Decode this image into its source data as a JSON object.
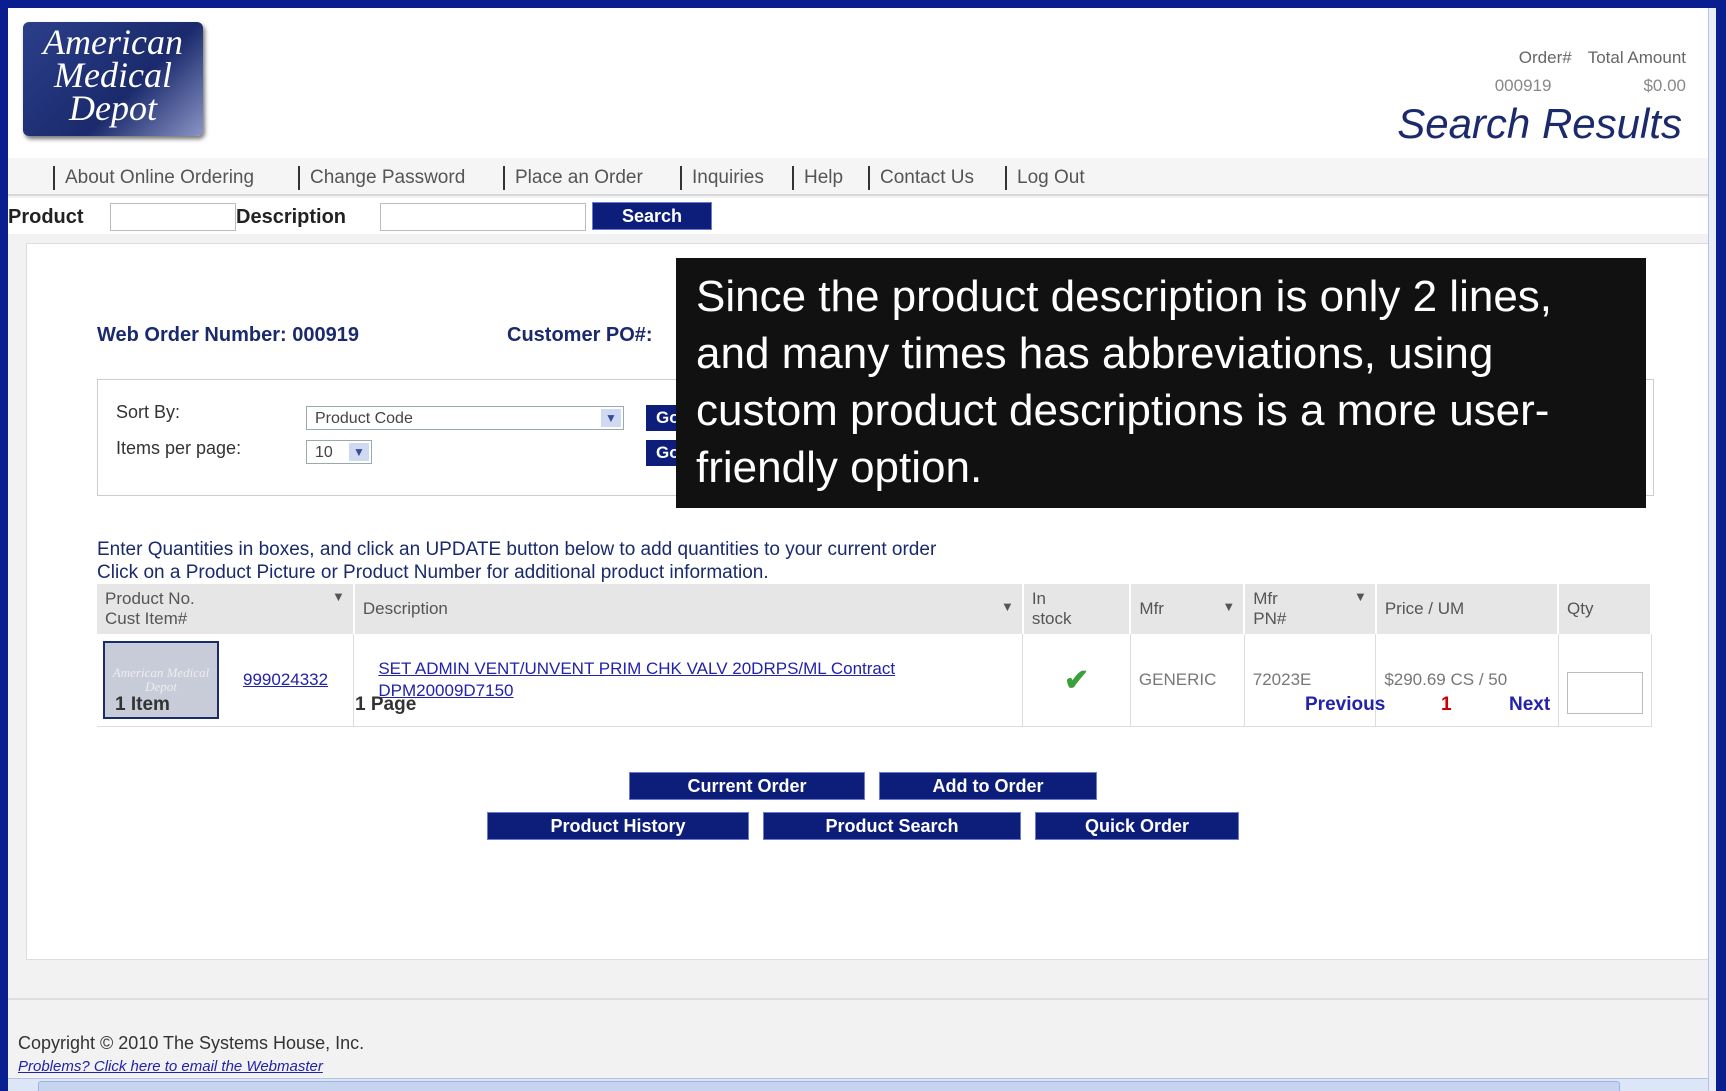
{
  "logo": {
    "lines": [
      "American",
      "Medical",
      "Depot"
    ]
  },
  "order_info": {
    "order_label": "Order#",
    "total_label": "Total Amount",
    "order_number": "000919",
    "total_amount": "$0.00"
  },
  "page_title": "Search Results",
  "nav": [
    "About Online Ordering",
    "Change Password",
    "Place an Order",
    "Inquiries",
    "Help",
    "Contact Us",
    "Log Out"
  ],
  "search": {
    "product_label": "Product",
    "description_label": "Description",
    "search_button": "Search"
  },
  "order": {
    "web_order_label": "Web Order Number: 000919",
    "customer_po_label": "Customer PO#:"
  },
  "sort": {
    "sort_by_label": "Sort By:",
    "sort_by_value": "Product Code",
    "items_per_page_label": "Items per page:",
    "items_per_page_value": "10",
    "go_label": "Go"
  },
  "instructions": [
    "Enter Quantities in boxes, and click an UPDATE button below to add quantities to your current order",
    "Click on a Product Picture or Product Number for additional product information."
  ],
  "table": {
    "headers": {
      "product_no": "Product No.",
      "cust_item": "Cust Item#",
      "description": "Description",
      "in_stock_1": "In",
      "in_stock_2": "stock",
      "mfr": "Mfr",
      "mfr_pn_1": "Mfr",
      "mfr_pn_2": "PN#",
      "price": "Price / UM",
      "qty": "Qty"
    },
    "row": {
      "thumb_text": "American Medical Depot",
      "product_no": "999024332",
      "description": "SET ADMIN VENT/UNVENT PRIM CHK VALV 20DRPS/ML Contract DPM20009D7150",
      "mfr": "GENERIC",
      "mfr_pn": "72023E",
      "price": "$290.69 CS / 50"
    }
  },
  "pager": {
    "items": "1 Item",
    "pages": "1 Page",
    "previous": "Previous",
    "current": "1",
    "next": "Next"
  },
  "buttons": {
    "current_order": "Current Order",
    "add_to_order": "Add to Order",
    "product_history": "Product History",
    "product_search": "Product Search",
    "quick_order": "Quick Order"
  },
  "footer": {
    "copyright": "Copyright © 2010 The Systems House, Inc.",
    "problems": "Problems? Click here to email the Webmaster"
  },
  "callout": "Since the product description is only 2 lines, and many times has abbreviations, using custom product descriptions is a more user-friendly option.",
  "colors": {
    "frame": "#0a1f8f",
    "brand_navy": "#0d1d7a",
    "link": "#2222aa",
    "accent_red": "#cc0000"
  }
}
